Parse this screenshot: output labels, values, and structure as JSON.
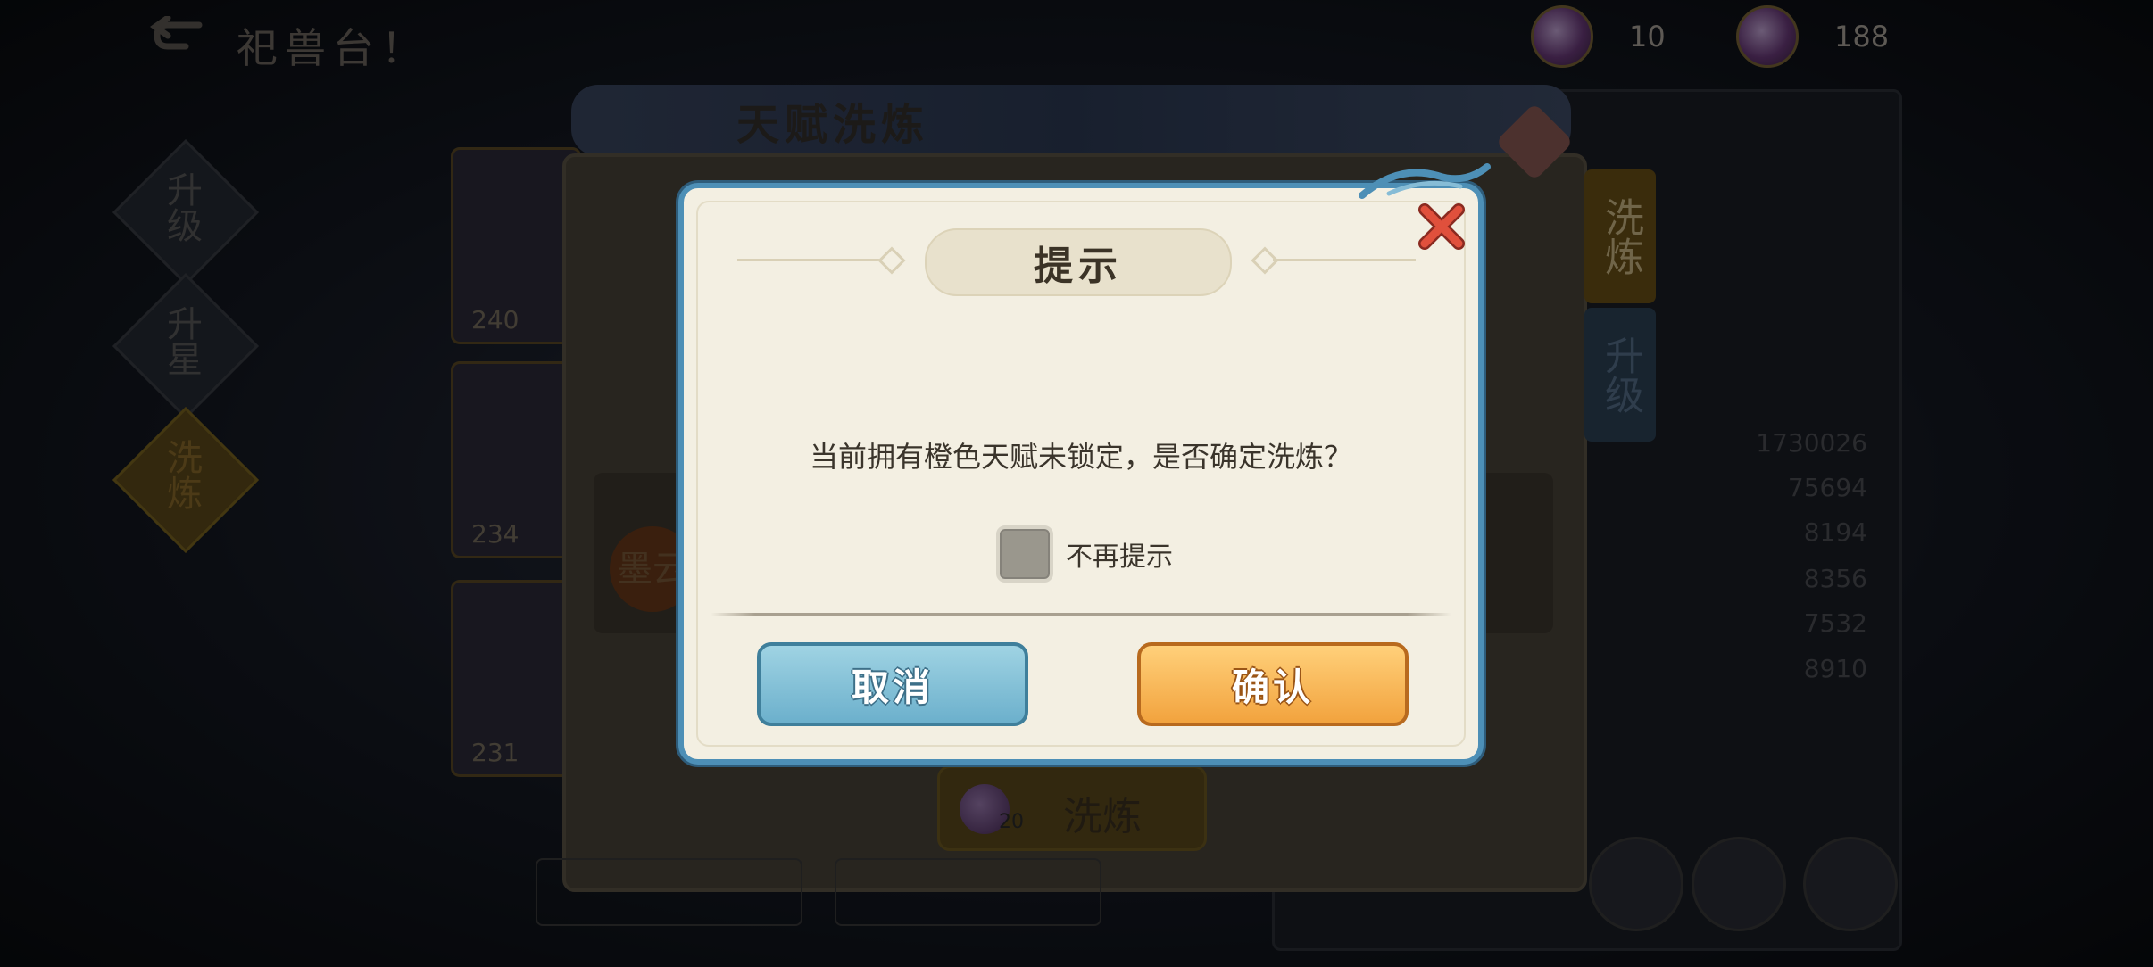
{
  "hud": {
    "screen_title": "祀兽台！",
    "currency_1_value": "10",
    "currency_2_value": "188"
  },
  "side_menu": [
    "升级",
    "升星",
    "洗炼"
  ],
  "cards": [
    "240",
    "234",
    "231"
  ],
  "background_panel": {
    "title": "天赋洗炼",
    "tabs": [
      "洗炼",
      "升级"
    ],
    "stats": [
      "1730026",
      "75694",
      "8194",
      "8356",
      "7532",
      "8910"
    ],
    "wash_button_label": "洗炼",
    "wash_cost": "20",
    "locked_badge": "墨云"
  },
  "dialog": {
    "title": "提示",
    "message": "当前拥有橙色天赋未锁定，是否确定洗炼？",
    "checkbox_label": "不再提示",
    "checkbox_checked": false,
    "cancel_label": "取消",
    "confirm_label": "确认"
  },
  "colors": {
    "dialog_border": "#4d8fb6",
    "cancel_button": "#6cb0cc",
    "confirm_button": "#f2a33e",
    "close_x": "#d84a3a"
  }
}
